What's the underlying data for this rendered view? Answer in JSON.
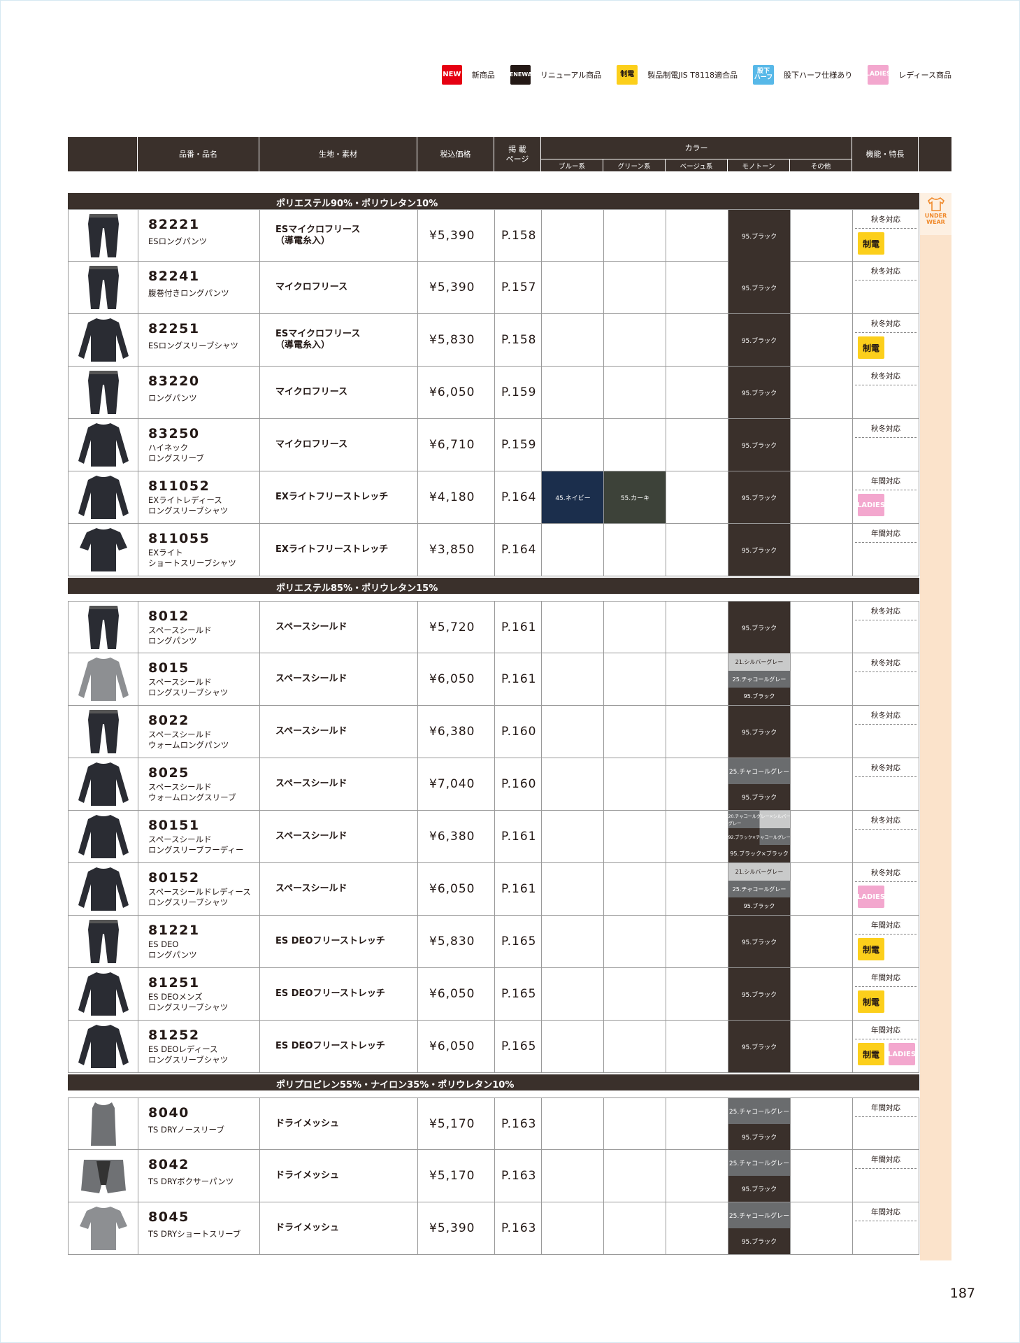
{
  "legend": [
    {
      "badge": "NEW",
      "label": "新商品",
      "style": "b-new",
      "icon": "new-badge"
    },
    {
      "badge": "RENEWAL",
      "label": "リニューアル商品",
      "style": "b-ren",
      "icon": "renewal-badge"
    },
    {
      "badge": "制電",
      "label": "製品制電JIS T8118適合品",
      "style": "b-sei",
      "icon": "antistatic-badge"
    },
    {
      "badge": "股下ハーフ",
      "label": "股下ハーフ仕様あり",
      "style": "b-half",
      "icon": "inseam-half-badge"
    },
    {
      "badge": "LADIES",
      "label": "レディース商品",
      "style": "b-lad",
      "icon": "ladies-badge"
    }
  ],
  "header": {
    "product": "品番・品名",
    "material": "生地・素材",
    "price": "税込価格",
    "page": "掲 載\nページ",
    "color": "カラー",
    "features": "機能・特長",
    "color_groups": [
      "ブルー系",
      "グリーン系",
      "ベージュ系",
      "モノトーン",
      "その他"
    ]
  },
  "sidebar": {
    "label1": "UNDER",
    "label2": "WEAR"
  },
  "page_number": "187",
  "sections": [
    {
      "title": "ポリエステル90%・ポリウレタン10%",
      "rows": [
        {
          "code": "82221",
          "name": "ESロングパンツ",
          "material": "ESマイクロフリース\n（導電糸入）",
          "price": "¥5,390",
          "page": "P.158",
          "blue": "",
          "green": "",
          "mono": [
            "95.ブラック"
          ],
          "season": "秋冬対応",
          "badges": [
            "制電"
          ],
          "shape": "pants"
        },
        {
          "code": "82241",
          "name": "腹巻付きロングパンツ",
          "material": "マイクロフリース",
          "price": "¥5,390",
          "page": "P.157",
          "blue": "",
          "green": "",
          "mono": [
            "95.ブラック"
          ],
          "season": "秋冬対応",
          "badges": [],
          "shape": "pants"
        },
        {
          "code": "82251",
          "name": "ESロングスリーブシャツ",
          "material": "ESマイクロフリース\n（導電糸入）",
          "price": "¥5,830",
          "page": "P.158",
          "blue": "",
          "green": "",
          "mono": [
            "95.ブラック"
          ],
          "season": "秋冬対応",
          "badges": [
            "制電"
          ],
          "shape": "shirt"
        },
        {
          "code": "83220",
          "name": "ロングパンツ",
          "material": "マイクロフリース",
          "price": "¥6,050",
          "page": "P.159",
          "blue": "",
          "green": "",
          "mono": [
            "95.ブラック"
          ],
          "season": "秋冬対応",
          "badges": [],
          "shape": "pants"
        },
        {
          "code": "83250",
          "name": "ハイネック\nロングスリーブ",
          "material": "マイクロフリース",
          "price": "¥6,710",
          "page": "P.159",
          "blue": "",
          "green": "",
          "mono": [
            "95.ブラック"
          ],
          "season": "秋冬対応",
          "badges": [],
          "shape": "shirt"
        },
        {
          "code": "811052",
          "name": "EXライトレディース\nロングスリーブシャツ",
          "material": "EXライトフリーストレッチ",
          "price": "¥4,180",
          "page": "P.164",
          "blue": "45.ネイビー",
          "green": "55.カーキ",
          "mono": [
            "95.ブラック"
          ],
          "season": "年間対応",
          "badges": [
            "LADIES"
          ],
          "shape": "shirt"
        },
        {
          "code": "811055",
          "name": "EXライト\nショートスリーブシャツ",
          "material": "EXライトフリーストレッチ",
          "price": "¥3,850",
          "page": "P.164",
          "blue": "",
          "green": "",
          "mono": [
            "95.ブラック"
          ],
          "season": "年間対応",
          "badges": [],
          "shape": "tee"
        }
      ]
    },
    {
      "title": "ポリエステル85%・ポリウレタン15%",
      "rows": [
        {
          "code": "8012",
          "name": "スペースシールド\nロングパンツ",
          "material": "スペースシールド",
          "price": "¥5,720",
          "page": "P.161",
          "blue": "",
          "green": "",
          "mono": [
            "95.ブラック"
          ],
          "season": "秋冬対応",
          "badges": [],
          "shape": "pants"
        },
        {
          "code": "8015",
          "name": "スペースシールド\nロングスリーブシャツ",
          "material": "スペースシールド",
          "price": "¥6,050",
          "page": "P.161",
          "blue": "",
          "green": "",
          "mono": [
            "21.シルバーグレー",
            "25.チャコールグレー",
            "95.ブラック"
          ],
          "season": "秋冬対応",
          "badges": [],
          "shape": "shirt-grey"
        },
        {
          "code": "8022",
          "name": "スペースシールド\nウォームロングパンツ",
          "material": "スペースシールド",
          "price": "¥6,380",
          "page": "P.160",
          "blue": "",
          "green": "",
          "mono": [
            "95.ブラック"
          ],
          "season": "秋冬対応",
          "badges": [],
          "shape": "pants"
        },
        {
          "code": "8025",
          "name": "スペースシールド\nウォームロングスリーブ",
          "material": "スペースシールド",
          "price": "¥7,040",
          "page": "P.160",
          "blue": "",
          "green": "",
          "mono": [
            "25.チャコールグレー",
            "95.ブラック"
          ],
          "season": "秋冬対応",
          "badges": [],
          "shape": "shirt"
        },
        {
          "code": "80151",
          "name": "スペースシールド\nロングスリーブフーディー",
          "material": "スペースシールド",
          "price": "¥6,380",
          "page": "P.161",
          "blue": "",
          "green": "",
          "mono": [
            "20.チャコールグレー×シルバーグレー",
            "92.ブラック×チャコールグレー",
            "95.ブラック×ブラック"
          ],
          "season": "秋冬対応",
          "badges": [],
          "shape": "shirt"
        },
        {
          "code": "80152",
          "name": "スペースシールドレディース\nロングスリーブシャツ",
          "material": "スペースシールド",
          "price": "¥6,050",
          "page": "P.161",
          "blue": "",
          "green": "",
          "mono": [
            "21.シルバーグレー",
            "25.チャコールグレー",
            "95.ブラック"
          ],
          "season": "秋冬対応",
          "badges": [
            "LADIES"
          ],
          "shape": "shirt"
        },
        {
          "code": "81221",
          "name": "ES DEO\nロングパンツ",
          "material": "ES DEOフリーストレッチ",
          "price": "¥5,830",
          "page": "P.165",
          "blue": "",
          "green": "",
          "mono": [
            "95.ブラック"
          ],
          "season": "年間対応",
          "badges": [
            "制電"
          ],
          "shape": "pants"
        },
        {
          "code": "81251",
          "name": "ES DEOメンズ\nロングスリーブシャツ",
          "material": "ES DEOフリーストレッチ",
          "price": "¥6,050",
          "page": "P.165",
          "blue": "",
          "green": "",
          "mono": [
            "95.ブラック"
          ],
          "season": "年間対応",
          "badges": [
            "制電"
          ],
          "shape": "shirt"
        },
        {
          "code": "81252",
          "name": "ES DEOレディース\nロングスリーブシャツ",
          "material": "ES DEOフリーストレッチ",
          "price": "¥6,050",
          "page": "P.165",
          "blue": "",
          "green": "",
          "mono": [
            "95.ブラック"
          ],
          "season": "年間対応",
          "badges": [
            "制電",
            "LADIES"
          ],
          "shape": "shirt"
        }
      ]
    },
    {
      "title": "ポリプロピレン55%・ナイロン35%・ポリウレタン10%",
      "rows": [
        {
          "code": "8040",
          "name": "TS DRYノースリーブ",
          "material": "ドライメッシュ",
          "price": "¥5,170",
          "page": "P.163",
          "blue": "",
          "green": "",
          "mono": [
            "25.チャコールグレー",
            "95.ブラック"
          ],
          "season": "年間対応",
          "badges": [],
          "shape": "tank"
        },
        {
          "code": "8042",
          "name": "TS DRYボクサーパンツ",
          "material": "ドライメッシュ",
          "price": "¥5,170",
          "page": "P.163",
          "blue": "",
          "green": "",
          "mono": [
            "25.チャコールグレー",
            "95.ブラック"
          ],
          "season": "年間対応",
          "badges": [],
          "shape": "boxer"
        },
        {
          "code": "8045",
          "name": "TS DRYショートスリーブ",
          "material": "ドライメッシュ",
          "price": "¥5,390",
          "page": "P.163",
          "blue": "",
          "green": "",
          "mono": [
            "25.チャコールグレー",
            "95.ブラック"
          ],
          "season": "年間対応",
          "badges": [],
          "shape": "tee-grey"
        }
      ]
    }
  ],
  "colors": {
    "dark": "#3a302b",
    "navy": "#1b2e4c",
    "khaki": "#3d4239",
    "silver": "#c9caca",
    "charcoal": "#6a6c6e",
    "sidebar": "#fbe3cb",
    "antistatic": "#fccf1b",
    "ladies": "#f3a7ce"
  }
}
